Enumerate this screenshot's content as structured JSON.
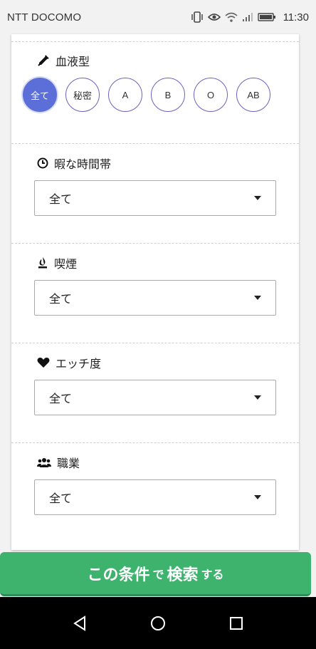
{
  "status_bar": {
    "carrier": "NTT DOCOMO",
    "time": "11:30"
  },
  "blood_type": {
    "title": "血液型",
    "options": [
      "全て",
      "秘密",
      "A",
      "B",
      "O",
      "AB"
    ],
    "selected": "全て"
  },
  "free_time": {
    "title": "暇な時間帯",
    "value": "全て"
  },
  "smoking": {
    "title": "喫煙",
    "value": "全て"
  },
  "ecchi": {
    "title": "エッチ度",
    "value": "全て"
  },
  "occupation": {
    "title": "職業",
    "value": "全て"
  },
  "search_button": {
    "part1": "この条件",
    "part2": "で",
    "part3": "検索",
    "part4": "する"
  },
  "colors": {
    "accent": "#5c6fd8",
    "chip_border": "#6a62b8",
    "search_green": "#3db36e"
  },
  "icons": {
    "blood_type": "eyedropper-icon",
    "free_time": "clock-icon",
    "smoking": "flame-icon",
    "ecchi": "heart-icon",
    "occupation": "users-icon"
  }
}
